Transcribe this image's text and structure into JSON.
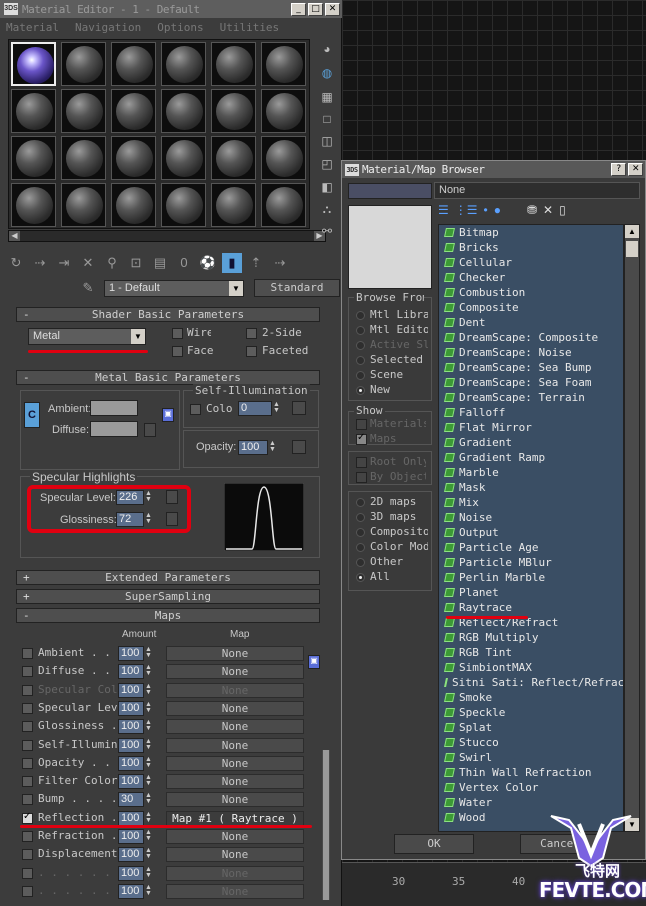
{
  "editor": {
    "title": "Material Editor - 1 - Default",
    "menu": [
      "Material",
      "Navigation",
      "Options",
      "Utilities"
    ],
    "material_name": "1 - Default",
    "material_type": "Standard",
    "tool_zero": "0"
  },
  "shader": {
    "header": "Shader Basic Parameters",
    "type": "Metal",
    "wire": "Wire",
    "two_sided": "2-Sided",
    "face": "Face Map",
    "faceted": "Faceted"
  },
  "metal": {
    "header": "Metal Basic Parameters",
    "ambient": "Ambient:",
    "diffuse": "Diffuse:",
    "self_illum": "Self-Illumination",
    "color": "Color",
    "color_val": "0",
    "opacity": "Opacity:",
    "opacity_val": "100",
    "spec_header": "Specular Highlights",
    "spec_level": "Specular Level:",
    "spec_level_val": "226",
    "glossiness": "Glossiness:",
    "glossiness_val": "72"
  },
  "rollouts": {
    "extended": "Extended Parameters",
    "supersampling": "SuperSampling",
    "maps": "Maps"
  },
  "maps": {
    "amount_hdr": "Amount",
    "map_hdr": "Map",
    "rows": [
      {
        "name": "Ambient . . . . . .",
        "amount": "100",
        "map": "None",
        "checked": false
      },
      {
        "name": "Diffuse . . . . . .",
        "amount": "100",
        "map": "None",
        "checked": false
      },
      {
        "name": "Specular Color . .",
        "amount": "100",
        "map": "None",
        "checked": false
      },
      {
        "name": "Specular Level . .",
        "amount": "100",
        "map": "None",
        "checked": false
      },
      {
        "name": "Glossiness . . . .",
        "amount": "100",
        "map": "None",
        "checked": false
      },
      {
        "name": "Self-Illumination .",
        "amount": "100",
        "map": "None",
        "checked": false
      },
      {
        "name": "Opacity . . . . . .",
        "amount": "100",
        "map": "None",
        "checked": false
      },
      {
        "name": "Filter Color . . .",
        "amount": "100",
        "map": "None",
        "checked": false
      },
      {
        "name": "Bump . . . . . . .",
        "amount": "30",
        "map": "None",
        "checked": false
      },
      {
        "name": "Reflection . . . .",
        "amount": "100",
        "map": "Map #1   ( Raytrace )",
        "checked": true
      },
      {
        "name": "Refraction . . . .",
        "amount": "100",
        "map": "None",
        "checked": false
      },
      {
        "name": "Displacement . . .",
        "amount": "100",
        "map": "None",
        "checked": false
      },
      {
        "name": ". . . . . . . . .",
        "amount": "100",
        "map": "None",
        "checked": false
      },
      {
        "name": ". . . . . . . . .",
        "amount": "100",
        "map": "None",
        "checked": false
      }
    ]
  },
  "browser": {
    "title": "Material/Map Browser",
    "name_field": "None",
    "browse_from": "Browse From",
    "browse_options": [
      "Mtl Library",
      "Mtl Editor",
      "Active Slot",
      "Selected",
      "Scene",
      "New"
    ],
    "browse_selected": 5,
    "show": "Show",
    "show_opts": [
      "Materials",
      "Maps"
    ],
    "root_opts": [
      "Root Only",
      "By Object"
    ],
    "filter_opts": [
      "2D maps",
      "3D maps",
      "Compositors",
      "Color Mods",
      "Other",
      "All"
    ],
    "filter_selected": 5,
    "items": [
      "Bitmap",
      "Bricks",
      "Cellular",
      "Checker",
      "Combustion",
      "Composite",
      "Dent",
      "DreamScape: Composite",
      "DreamScape: Noise",
      "DreamScape: Sea Bump",
      "DreamScape: Sea Foam",
      "DreamScape: Terrain",
      "Falloff",
      "Flat Mirror",
      "Gradient",
      "Gradient Ramp",
      "Marble",
      "Mask",
      "Mix",
      "Noise",
      "Output",
      "Particle Age",
      "Particle MBlur",
      "Perlin Marble",
      "Planet",
      "Raytrace",
      "Reflect/Refract",
      "RGB Multiply",
      "RGB Tint",
      "SimbiontMAX",
      "Sitni Sati: Reflect/Refract",
      "Smoke",
      "Speckle",
      "Splat",
      "Stucco",
      "Swirl",
      "Thin Wall Refraction",
      "Vertex Color",
      "Water",
      "Wood"
    ],
    "ok": "OK",
    "cancel": "Cancel"
  },
  "ruler": [
    "30",
    "35",
    "40"
  ],
  "watermark": {
    "brand": "FEVTE.COM",
    "cn": "飞特网"
  }
}
